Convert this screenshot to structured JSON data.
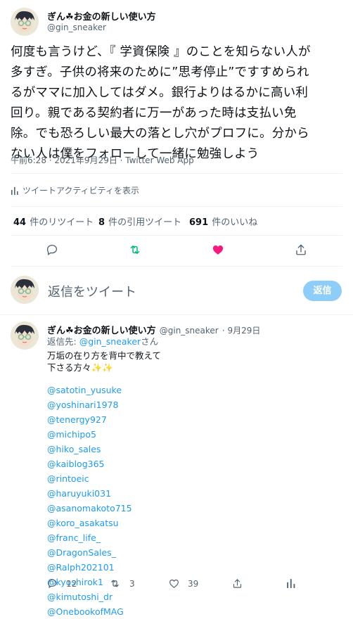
{
  "author": {
    "name": "ぎん☘お金の新しい使い方",
    "handle": "@gin_sneaker"
  },
  "tweet": {
    "lines": [
      "何度も言うけど、『 学資保険 』のことを知らない人が",
      "多すぎ。子供の将来のために”思考停止”ですすめられ",
      "るがママに加入してはダメ。銀行よりはるかに高い利",
      "回り。親である契約者に万一があった時は支払い免",
      "除。でも恐ろしい最大の落とし穴がプロフに。分から",
      "ない人は僕をフォローして一緒に勉強しよう"
    ],
    "timestamp": "午前6:28 · 2021年9月29日 · Twitter Web App",
    "activity_label": "ツイートアクティビティを表示"
  },
  "stats": {
    "retweets_num": "44",
    "retweets_label": "件のリツイート",
    "quotes_num": "8",
    "quotes_label": "件の引用ツイート",
    "likes_num": "691",
    "likes_label": "件のいいね"
  },
  "reply_box": {
    "placeholder": "返信をツイート",
    "button": "返信"
  },
  "reply": {
    "name": "ぎん☘お金の新しい使い方",
    "handle": "@gin_sneaker",
    "date": "· 9月29日",
    "replying_prefix": "返信先: ",
    "replying_handle": "@gin_sneaker",
    "replying_suffix": "さん",
    "line1": "万垢の在り方を背中で教えて",
    "line2": "下さる方々✨✨",
    "mentions": [
      "@satotin_yusuke",
      "@yoshinari1978",
      "@tenergy927",
      "@michipo5",
      "@hiko_sales",
      "@kaiblog365",
      "@rintoeic",
      "@haruyuki031",
      "@asanomakoto715",
      "@koro_asakatsu",
      "@franc_life_",
      "@DragonSales_",
      "@Ralph202101",
      "@kyoshirok1",
      "@kimutoshi_dr",
      "@OnebookofMAG"
    ],
    "reply_count": "12",
    "retweet_count": "3",
    "like_count": "39"
  },
  "colors": {
    "accent": "#1d9bf0",
    "retweet_green": "#00ba7c",
    "like_pink": "#f91880",
    "muted": "#536471"
  },
  "icons": [
    "reply-icon",
    "retweet-icon",
    "like-icon",
    "share-icon",
    "analytics-icon"
  ]
}
